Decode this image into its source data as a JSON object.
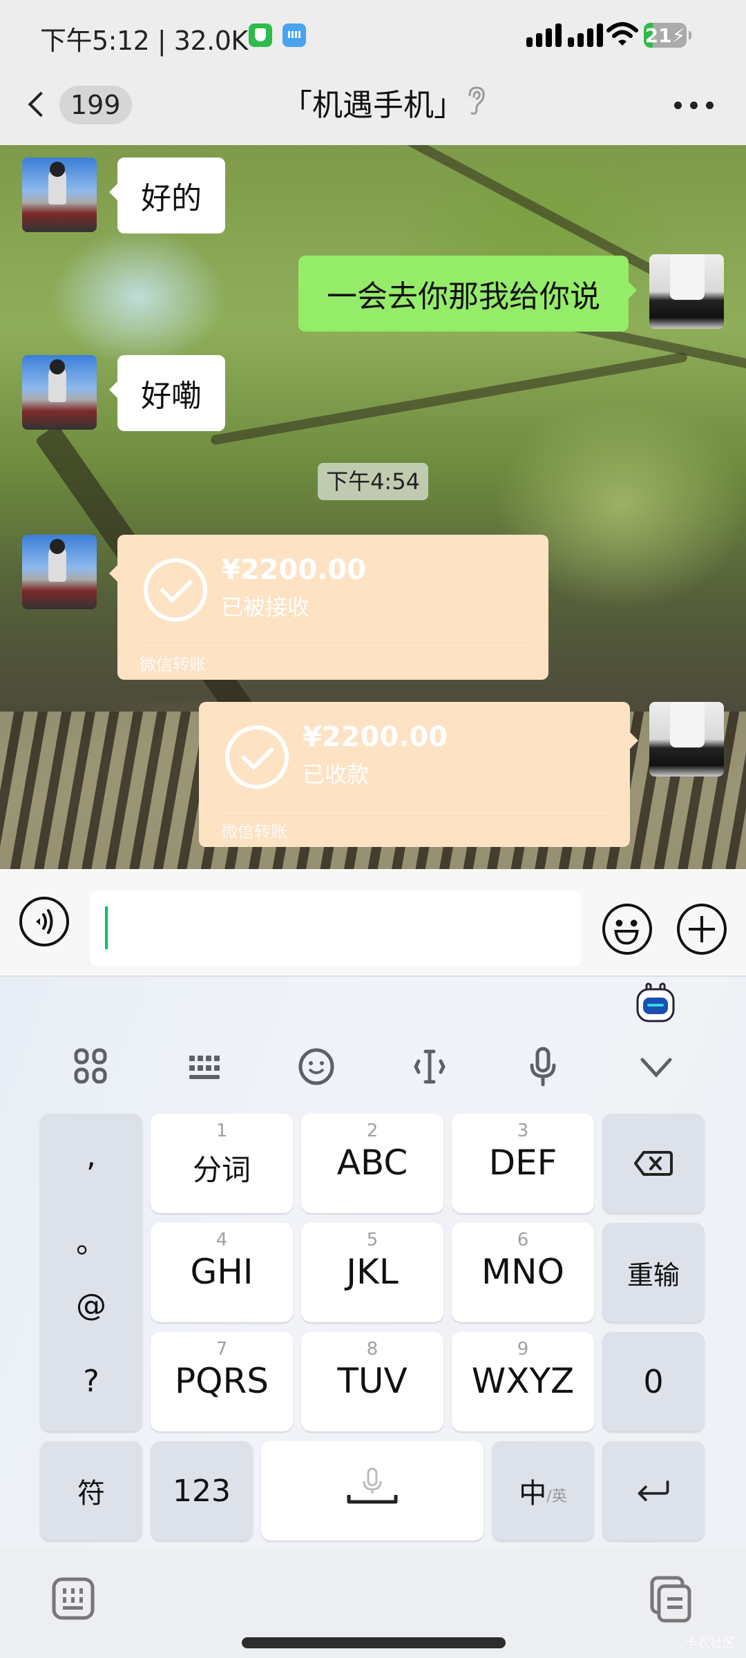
{
  "status_bar": {
    "time": "下午5:12",
    "network_speed": "32.0K",
    "status_text": "下午5:12 | 32.0K",
    "icons": [
      "shield-icon",
      "keyboard-icon",
      "signal-icon",
      "signal-icon",
      "wifi-icon",
      "battery-charging-icon"
    ],
    "battery_level": "21",
    "battery_fraction": 0.21,
    "colors": {
      "battery_fill": "#2dbb4a",
      "shield": "#2dbb4a",
      "keyboard_badge": "#4aa3ef"
    }
  },
  "header": {
    "back_icon": "chevron-left-icon",
    "unread_count": "199",
    "title": "「机遇手机」",
    "ear_icon": "ear-icon",
    "more_icon": "more-horizontal-icon"
  },
  "messages": [
    {
      "sender": "other",
      "type": "text",
      "text": "好的"
    },
    {
      "sender": "self",
      "type": "text",
      "text": "一会去你那我给你说"
    },
    {
      "sender": "other",
      "type": "text",
      "text": "好嘞"
    },
    {
      "type": "timestamp",
      "text": "下午4:54"
    },
    {
      "sender": "other",
      "type": "transfer",
      "amount": "¥2200.00",
      "status": "已被接收",
      "label": "微信转账"
    },
    {
      "sender": "self",
      "type": "transfer",
      "amount": "¥2200.00",
      "status": "已收款",
      "label": "微信转账"
    }
  ],
  "input_bar": {
    "voice_icon": "voice-icon",
    "input_value": "",
    "emoji_icon": "emoji-icon",
    "plus_icon": "plus-circle-icon",
    "caret_color": "#07c160"
  },
  "keyboard": {
    "assistant_icon": "robot-assistant-icon",
    "toolbar": [
      "apps-grid-icon",
      "keyboard-layout-icon",
      "emoji-icon",
      "cursor-move-icon",
      "microphone-icon",
      "collapse-chevron-icon"
    ],
    "punctuation": [
      ",",
      "。",
      "@",
      "?"
    ],
    "keys": [
      {
        "num": "1",
        "label": "分词"
      },
      {
        "num": "2",
        "label": "ABC"
      },
      {
        "num": "3",
        "label": "DEF"
      },
      {
        "num": "4",
        "label": "GHI"
      },
      {
        "num": "5",
        "label": "JKL"
      },
      {
        "num": "6",
        "label": "MNO"
      },
      {
        "num": "7",
        "label": "PQRS"
      },
      {
        "num": "8",
        "label": "TUV"
      },
      {
        "num": "9",
        "label": "WXYZ"
      }
    ],
    "backspace_icon": "backspace-icon",
    "reinput_label": "重输",
    "zero_label": "0",
    "symbol_label": "符",
    "numeric_label": "123",
    "space_icon": "space-microphone-icon",
    "lang_primary": "中",
    "lang_secondary": "/英",
    "enter_icon": "return-icon"
  },
  "bottom_bar": {
    "left_icon": "keyboard-switch-icon",
    "right_icon": "clipboard-icon",
    "watermark": "卡农社区"
  }
}
